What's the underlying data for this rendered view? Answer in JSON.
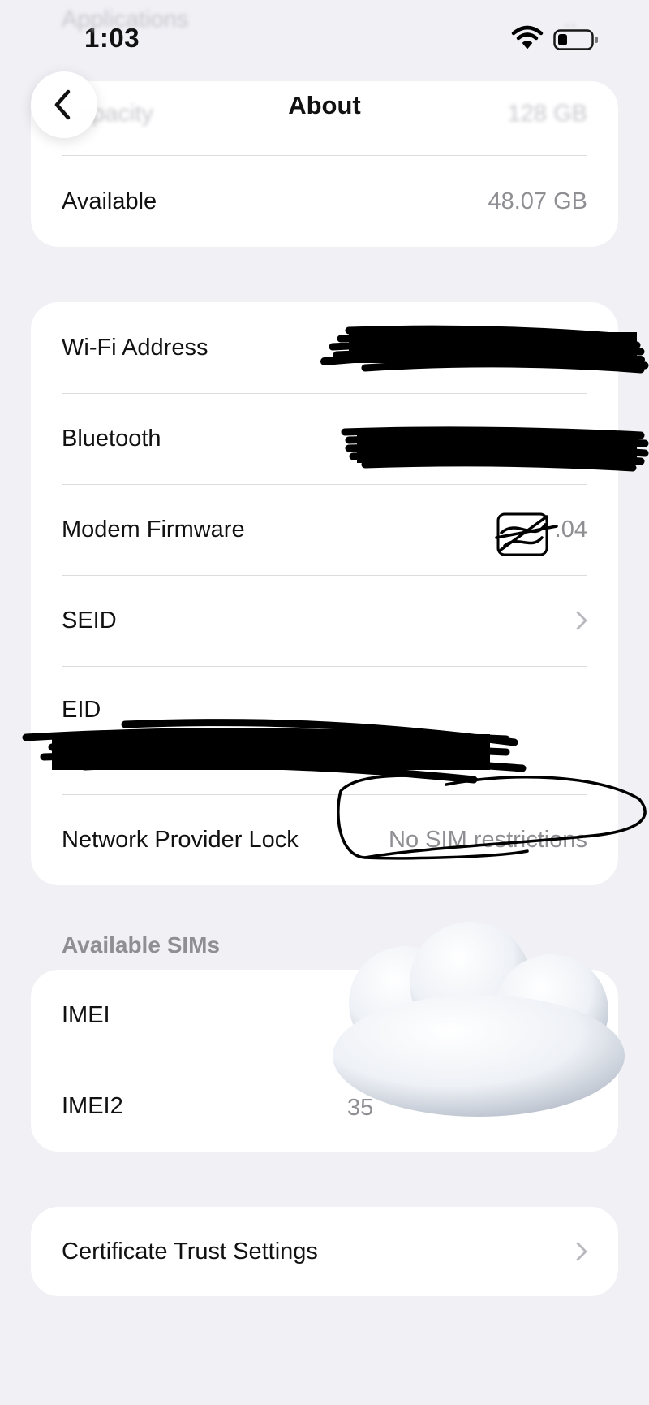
{
  "status_bar": {
    "time": "1:03"
  },
  "nav": {
    "title": "About",
    "back_icon": "chevron-left-icon"
  },
  "background_rows": {
    "applications": "Applications",
    "capacity_label": "Capacity",
    "capacity_value": "128 GB"
  },
  "storage": {
    "available_label": "Available",
    "available_value": "48.07 GB"
  },
  "network_info": {
    "wifi_label": "Wi-Fi Address",
    "bluetooth_label": "Bluetooth",
    "modem_label": "Modem Firmware",
    "modem_value_visible": ".04",
    "seid_label": "SEID",
    "eid_label": "EID",
    "lock_label": "Network Provider Lock",
    "lock_value": "No SIM restrictions"
  },
  "sims": {
    "header": "Available SIMs",
    "imei_label": "IMEI",
    "imei2_label": "IMEI2",
    "imei2_value_visible": "35"
  },
  "certificates": {
    "label": "Certificate Trust Settings"
  },
  "colors": {
    "background": "#f0f0f5",
    "card": "#ffffff",
    "secondary_text": "#8e8e93",
    "redaction": "#000000"
  }
}
